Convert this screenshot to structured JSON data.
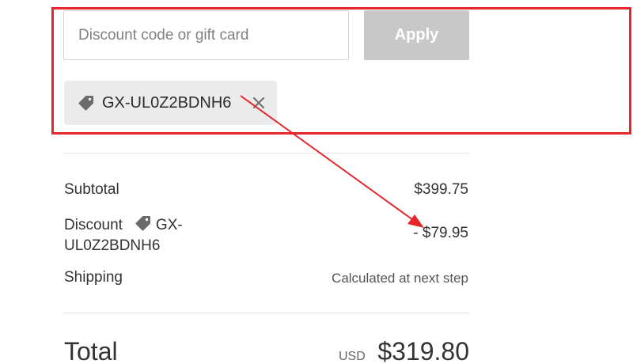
{
  "discount_form": {
    "input_placeholder": "Discount code or gift card",
    "input_value": "",
    "apply_label": "Apply"
  },
  "applied_code": {
    "code": "GX-UL0Z2BDNH6",
    "tag_icon": "tag-icon",
    "remove_icon": "close-icon"
  },
  "summary": {
    "subtotal_label": "Subtotal",
    "subtotal_value": "$399.75",
    "discount_label": "Discount",
    "discount_code_line1": "GX-",
    "discount_code_line2": "UL0Z2BDNH6",
    "discount_value": "- $79.95",
    "shipping_label": "Shipping",
    "shipping_value": "Calculated at next step",
    "total_label": "Total",
    "total_currency": "USD",
    "total_value": "$319.80"
  },
  "annotation": {
    "color": "#e5262b"
  },
  "colors": {
    "apply_button_bg": "#c8c8c8",
    "chip_bg": "#ebebeb",
    "text": "#333333"
  }
}
